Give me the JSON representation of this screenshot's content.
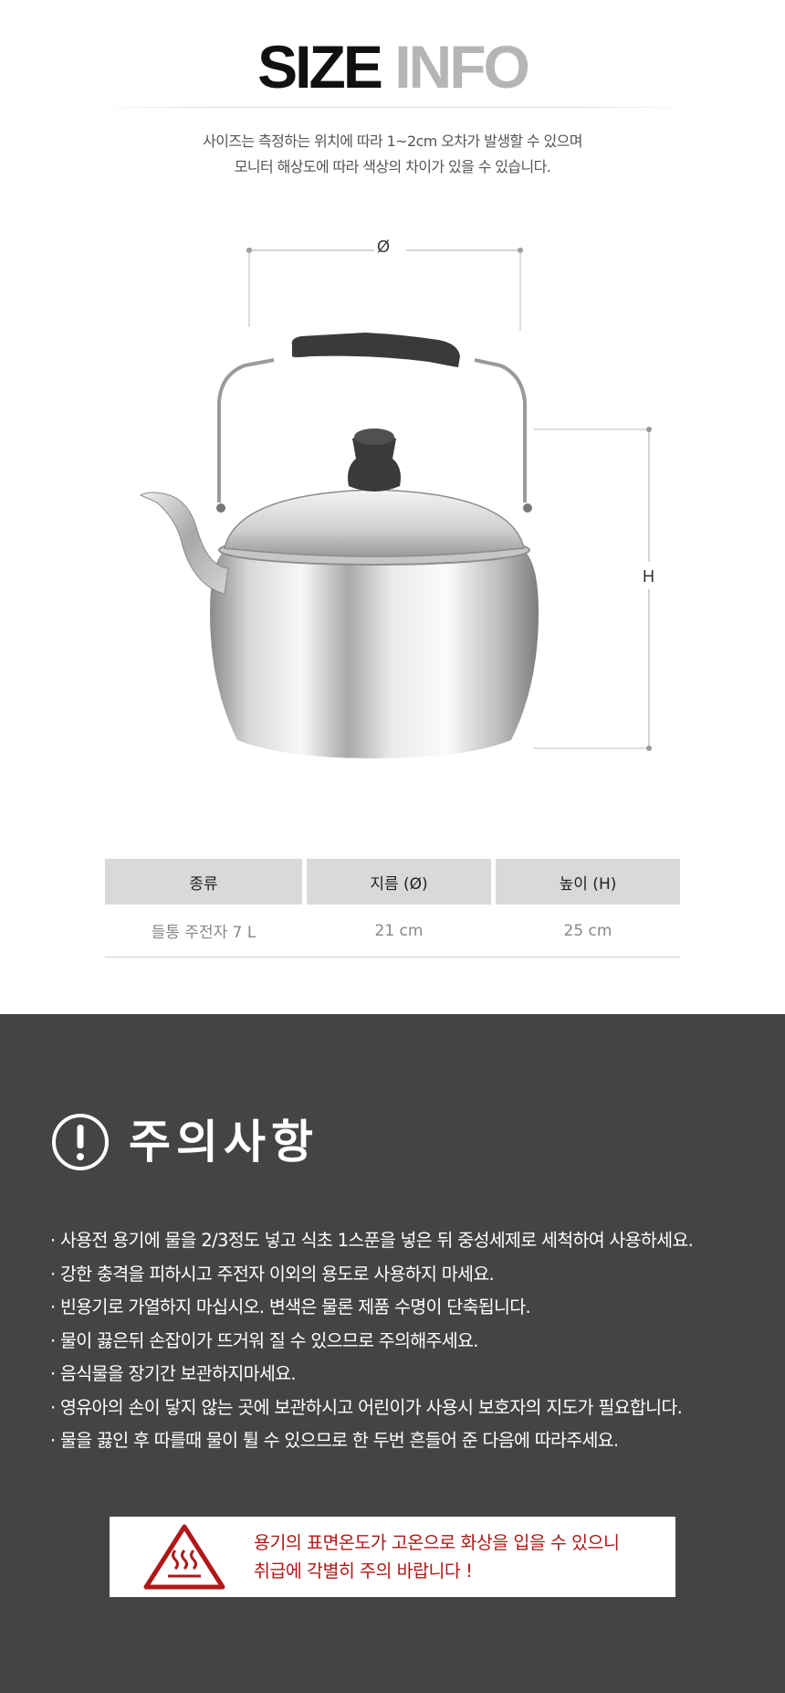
{
  "header": {
    "title_part1": "SIZE",
    "title_part2": "INFO",
    "notice_line1": "사이즈는 측정하는 위치에 따라 1~2cm 오차가 발생할 수 있으며",
    "notice_line2": "모니터 해상도에 따라 색상의 차이가 있을 수 있습니다."
  },
  "diagram": {
    "diameter_label": "Ø",
    "height_label": "H"
  },
  "spec_table": {
    "headers": [
      "종류",
      "지름 (Ø)",
      "높이 (H)"
    ],
    "rows": [
      [
        "들통 주전자 7 L",
        "21 cm",
        "25 cm"
      ]
    ]
  },
  "caution": {
    "title": "주의사항",
    "items": [
      "· 사용전 용기에 물을 2/3정도 넣고 식초 1스푼을 넣은 뒤 중성세제로 세척하여 사용하세요.",
      "· 강한 충격을 피하시고 주전자 이외의 용도로 사용하지 마세요.",
      "· 빈용기로 가열하지 마십시오. 변색은 물론 제품 수명이 단축됩니다.",
      "· 물이 끓은뒤 손잡이가 뜨거워 질 수 있으므로 주의해주세요.",
      "· 음식물을 장기간 보관하지마세요.",
      "· 영유아의 손이 닿지 않는 곳에 보관하시고 어린이가 사용시 보호자의 지도가 필요합니다.",
      "· 물을 끓인 후 따를때 물이 튈 수 있으므로 한 두번 흔들어 준 다음에 따라주세요."
    ],
    "warning_line1": "용기의 표면온도가 고온으로 화상을 입을 수 있으니",
    "warning_line2": "취급에 각별히 주의 바랍니다 !",
    "warning_color": "#b01818"
  },
  "colors": {
    "title_dark": "#111111",
    "title_light": "#b5b5b5",
    "caution_bg": "#444444",
    "table_header_bg": "#d9d9d9"
  }
}
